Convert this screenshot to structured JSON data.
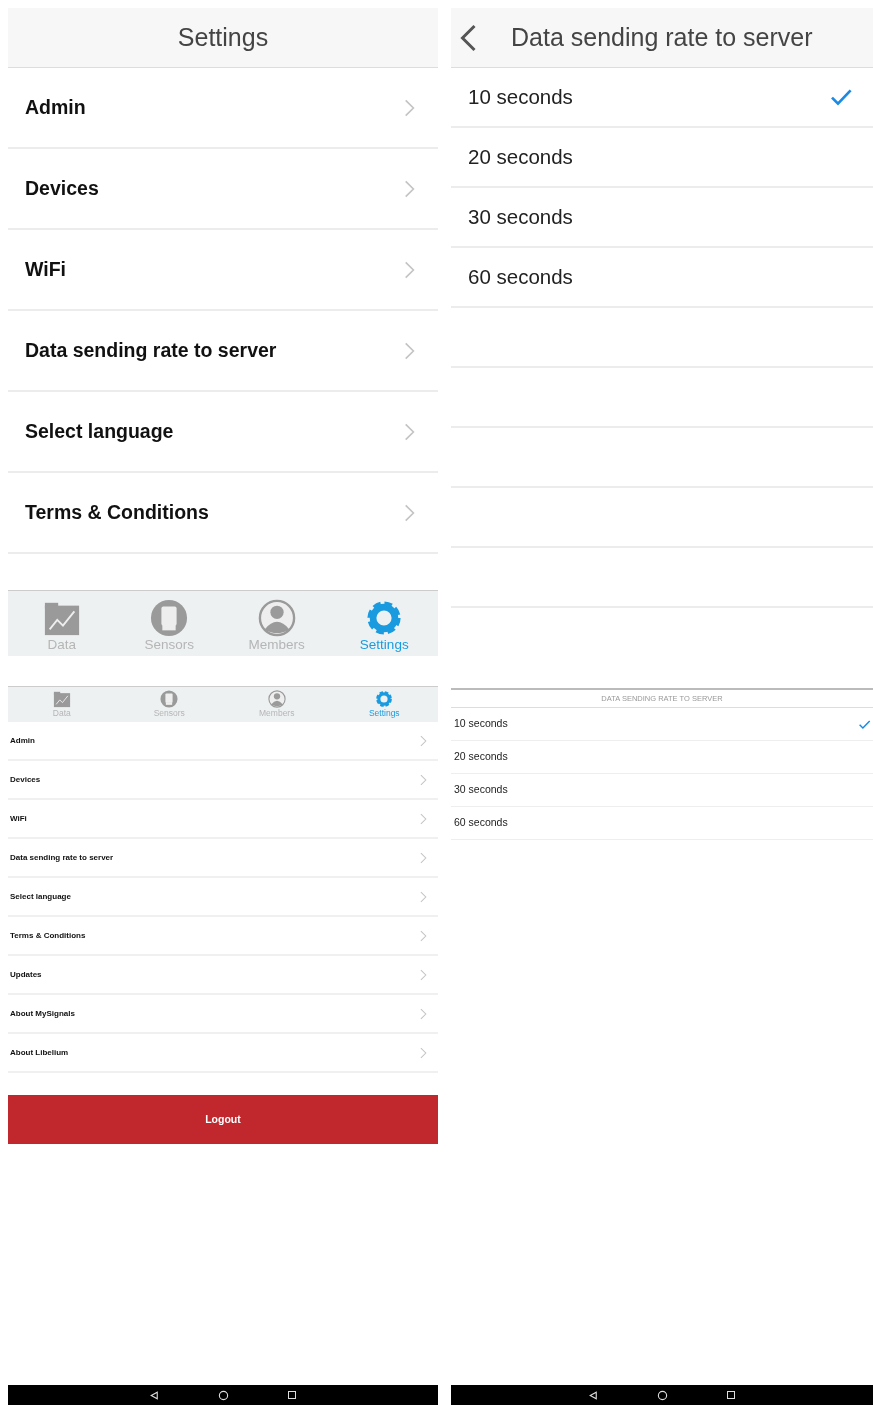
{
  "settings_screen": {
    "title": "Settings",
    "items": [
      {
        "label": "Admin"
      },
      {
        "label": "Devices"
      },
      {
        "label": "WiFi"
      },
      {
        "label": "Data sending rate to server"
      },
      {
        "label": "Select language"
      },
      {
        "label": "Terms & Conditions"
      }
    ],
    "tab_bar": [
      {
        "label": "Data",
        "kind": "chart",
        "selected": false
      },
      {
        "label": "Sensors",
        "kind": "chip",
        "selected": false
      },
      {
        "label": "Members",
        "kind": "person",
        "selected": false
      },
      {
        "label": "Settings",
        "kind": "gear",
        "selected": true
      }
    ]
  },
  "rate_screen": {
    "title": "Data sending rate to server",
    "options": [
      {
        "label": "10 seconds",
        "selected": true
      },
      {
        "label": "20 seconds",
        "selected": false
      },
      {
        "label": "30 seconds",
        "selected": false
      },
      {
        "label": "60 seconds",
        "selected": false
      }
    ]
  },
  "compact_settings": {
    "tab_bar": [
      {
        "label": "Data",
        "kind": "chart",
        "selected": false
      },
      {
        "label": "Sensors",
        "kind": "chip",
        "selected": false
      },
      {
        "label": "Members",
        "kind": "person",
        "selected": false
      },
      {
        "label": "Settings",
        "kind": "gear",
        "selected": true
      }
    ],
    "items": [
      {
        "label": "Admin"
      },
      {
        "label": "Devices"
      },
      {
        "label": "WiFi"
      },
      {
        "label": "Data sending rate to server"
      },
      {
        "label": "Select language"
      },
      {
        "label": "Terms & Conditions"
      },
      {
        "label": "Updates"
      },
      {
        "label": "About MySignals"
      },
      {
        "label": "About Libelium"
      }
    ],
    "logout": "Logout"
  },
  "compact_rate": {
    "title": "DATA SENDING RATE TO SERVER",
    "options": [
      {
        "label": "10 seconds",
        "selected": true
      },
      {
        "label": "20 seconds",
        "selected": false
      },
      {
        "label": "30 seconds",
        "selected": false
      },
      {
        "label": "60 seconds",
        "selected": false
      }
    ]
  }
}
